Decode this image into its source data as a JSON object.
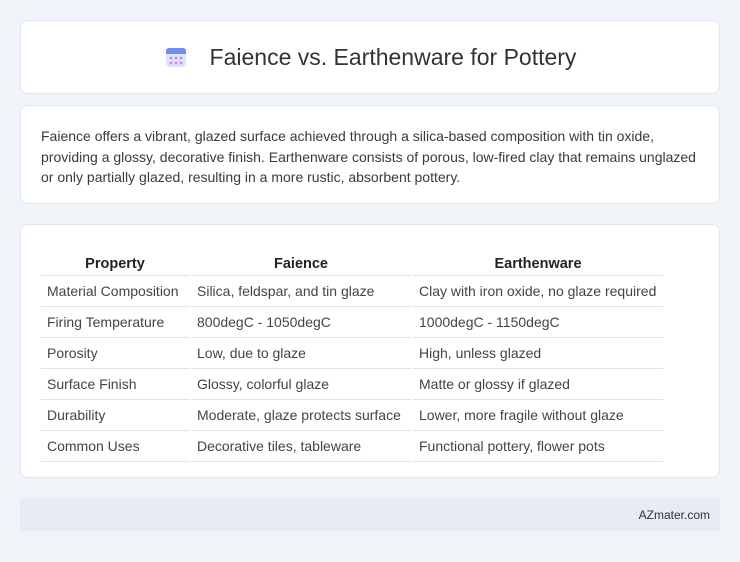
{
  "header": {
    "icon": "calendar-icon",
    "title": "Faience vs. Earthenware for Pottery"
  },
  "description": "Faience offers a vibrant, glazed surface achieved through a silica-based composition with tin oxide, providing a glossy, decorative finish. Earthenware consists of porous, low-fired clay that remains unglazed or only partially glazed, resulting in a more rustic, absorbent pottery.",
  "table": {
    "headers": [
      "Property",
      "Faience",
      "Earthenware"
    ],
    "rows": [
      [
        "Material Composition",
        "Silica, feldspar, and tin glaze",
        "Clay with iron oxide, no glaze required"
      ],
      [
        "Firing Temperature",
        "800degC - 1050degC",
        "1000degC - 1150degC"
      ],
      [
        "Porosity",
        "Low, due to glaze",
        "High, unless glazed"
      ],
      [
        "Surface Finish",
        "Glossy, colorful glaze",
        "Matte or glossy if glazed"
      ],
      [
        "Durability",
        "Moderate, glaze protects surface",
        "Lower, more fragile without glaze"
      ],
      [
        "Common Uses",
        "Decorative tiles, tableware",
        "Functional pottery, flower pots"
      ]
    ]
  },
  "footer": {
    "brand": "AZmater.com"
  },
  "colors": {
    "background": "#f0f3f8",
    "card": "#ffffff",
    "footer": "#e6ebf4",
    "icon_accent": "#7b8ff0"
  }
}
